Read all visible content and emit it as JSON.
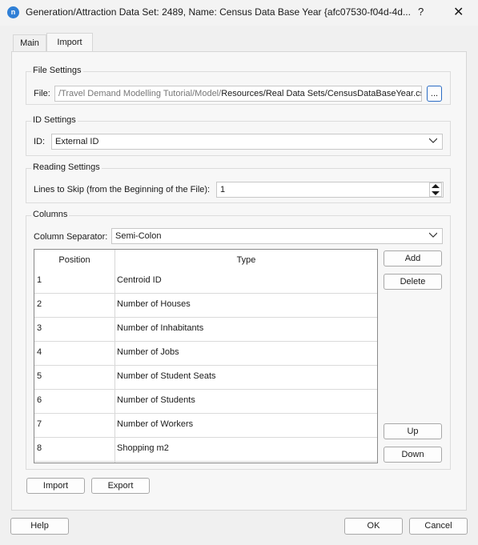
{
  "window": {
    "title": "Generation/Attraction Data Set: 2489, Name: Census Data Base Year  {afc07530-f04d-4d...",
    "help_glyph": "?",
    "close_glyph": "✕",
    "app_icon_glyph": "n"
  },
  "tabs": [
    {
      "label": "Main"
    },
    {
      "label": "Import"
    }
  ],
  "file_settings": {
    "group_title": "File Settings",
    "file_label": "File:",
    "path_prefix": "/Travel Demand Modelling Tutorial/Model/",
    "path_suffix": "Resources/Real Data Sets/CensusDataBaseYear.csv",
    "browse_label": "..."
  },
  "id_settings": {
    "group_title": "ID Settings",
    "id_label": "ID:",
    "id_value": "External ID"
  },
  "reading_settings": {
    "group_title": "Reading Settings",
    "lines_label": "Lines to Skip (from the Beginning of the File):",
    "lines_value": "1"
  },
  "columns": {
    "group_title": "Columns",
    "separator_label": "Column Separator:",
    "separator_value": "Semi-Colon",
    "headers": {
      "position": "Position",
      "type": "Type"
    },
    "rows": [
      {
        "position": "1",
        "type": "Centroid ID"
      },
      {
        "position": "2",
        "type": "Number of Houses"
      },
      {
        "position": "3",
        "type": "Number of Inhabitants"
      },
      {
        "position": "4",
        "type": "Number of Jobs"
      },
      {
        "position": "5",
        "type": "Number of Student Seats"
      },
      {
        "position": "6",
        "type": "Number of Students"
      },
      {
        "position": "7",
        "type": "Number of Workers"
      },
      {
        "position": "8",
        "type": "Shopping m2"
      }
    ],
    "add_label": "Add",
    "delete_label": "Delete",
    "up_label": "Up",
    "down_label": "Down"
  },
  "import_label": "Import",
  "export_label": "Export",
  "footer": {
    "help_label": "Help",
    "ok_label": "OK",
    "cancel_label": "Cancel"
  },
  "colors": {
    "accent": "#2b6cc4",
    "app_icon": "#2f7fd6"
  }
}
